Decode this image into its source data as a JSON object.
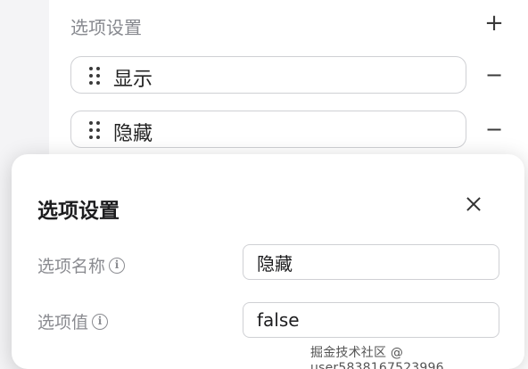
{
  "background": {
    "header_title": "选项设置",
    "add_icon": "+",
    "options": [
      {
        "label": "显示"
      },
      {
        "label": "隐藏"
      }
    ],
    "minus_icon": "−"
  },
  "modal": {
    "title": "选项设置",
    "fields": [
      {
        "label": "选项名称",
        "value": "隐藏"
      },
      {
        "label": "选项值",
        "value": "false"
      }
    ]
  },
  "watermark": "掘金技术社区 @ user5838167523996"
}
